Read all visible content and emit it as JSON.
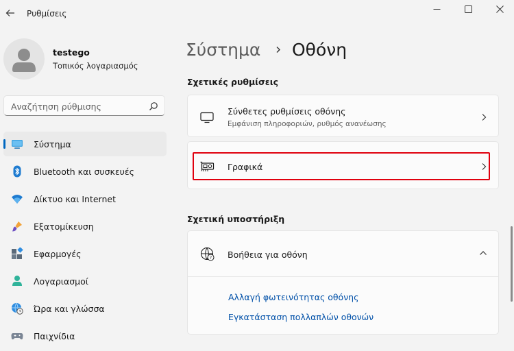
{
  "window": {
    "title": "Ρυθμίσεις"
  },
  "profile": {
    "name": "testego",
    "account_type": "Τοπικός λογαριασμός"
  },
  "search": {
    "placeholder": "Αναζήτηση ρύθμισης"
  },
  "sidebar": {
    "items": [
      {
        "label": "Σύστημα",
        "icon": "system-monitor-icon",
        "selected": true
      },
      {
        "label": "Bluetooth και συσκευές",
        "icon": "bluetooth-icon"
      },
      {
        "label": "Δίκτυο και Internet",
        "icon": "wifi-icon"
      },
      {
        "label": "Εξατομίκευση",
        "icon": "paintbrush-icon"
      },
      {
        "label": "Εφαρμογές",
        "icon": "apps-icon"
      },
      {
        "label": "Λογαριασμοί",
        "icon": "person-icon"
      },
      {
        "label": "Ώρα και γλώσσα",
        "icon": "globe-clock-icon"
      },
      {
        "label": "Παιχνίδια",
        "icon": "gamepad-icon"
      }
    ]
  },
  "breadcrumb": {
    "parent": "Σύστημα",
    "current": "Οθόνη"
  },
  "related_settings": {
    "heading": "Σχετικές ρυθμίσεις",
    "items": [
      {
        "title": "Σύνθετες ρυθμίσεις οθόνης",
        "subtitle": "Εμφάνιση πληροφοριών, ρυθμός ανανέωσης",
        "icon": "monitor-icon"
      },
      {
        "title": "Γραφικά",
        "icon": "graphics-card-icon"
      }
    ]
  },
  "related_support": {
    "heading": "Σχετική υποστήριξη",
    "help_title": "Βοήθεια για οθόνη",
    "links": [
      "Αλλαγή φωτεινότητας οθόνης",
      "Εγκατάσταση πολλαπλών οθονών"
    ]
  },
  "colors": {
    "accent": "#0067c0",
    "highlight_border": "#e0000e",
    "link": "#0050a8"
  }
}
